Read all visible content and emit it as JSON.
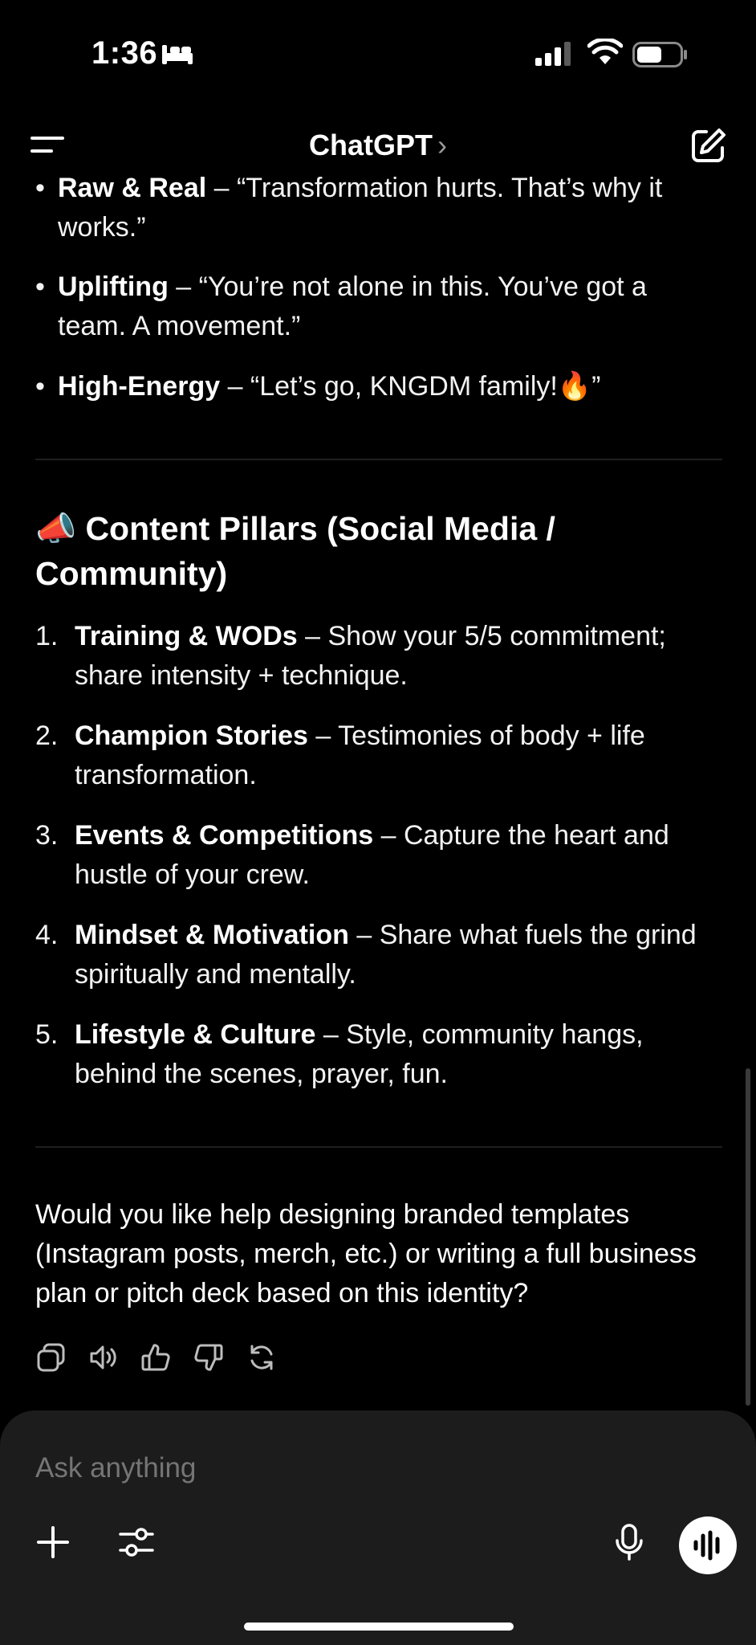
{
  "status": {
    "time": "1:36"
  },
  "header": {
    "title": "ChatGPT",
    "chevron": "›"
  },
  "icons": {
    "menu": "menu-icon",
    "compose": "compose-icon",
    "sleep": "bed-icon",
    "signal": "signal-icon",
    "wifi": "wifi-icon",
    "battery": "battery-icon",
    "copy": "copy-icon",
    "speaker": "speaker-icon",
    "like": "thumbs-up-icon",
    "dislike": "thumbs-down-icon",
    "regenerate": "regenerate-icon",
    "plus": "plus-icon",
    "tools": "tools-icon",
    "mic": "mic-icon",
    "voice": "voice-mode-icon",
    "megaphone": "megaphone-icon",
    "fire": "fire-icon"
  },
  "message": {
    "tone_items": [
      {
        "bold": "Raw & Real",
        "text": " – “Transformation hurts. That’s why it works.”"
      },
      {
        "bold": "Uplifting",
        "text": " – “You’re not alone in this. You’ve got a team. A movement.”"
      },
      {
        "bold": "High-Energy",
        "text": " – “Let’s go, KNGDM family!🔥”"
      }
    ],
    "pillars_heading": "📣 Content Pillars (Social Media / Community)",
    "pillars": [
      {
        "num": "1.",
        "bold": "Training & WODs",
        "text": " – Show your 5/5 commitment; share intensity + technique."
      },
      {
        "num": "2.",
        "bold": "Champion Stories",
        "text": " – Testimonies of body + life transformation."
      },
      {
        "num": "3.",
        "bold": "Events & Competitions",
        "text": " – Capture the heart and hustle of your crew."
      },
      {
        "num": "4.",
        "bold": "Mindset & Motivation",
        "text": " – Share what fuels the grind spiritually and mentally."
      },
      {
        "num": "5.",
        "bold": "Lifestyle & Culture",
        "text": " – Style, community hangs, behind the scenes, prayer, fun."
      }
    ],
    "followup": "Would you like help designing branded templates (Instagram posts, merch, etc.) or writing a full business plan or pitch deck based on this identity?"
  },
  "composer": {
    "placeholder": "Ask anything"
  },
  "colors": {
    "background": "#000000",
    "composer": "#1c1c1c",
    "text": "#ffffff",
    "muted": "#8e8e8e"
  }
}
